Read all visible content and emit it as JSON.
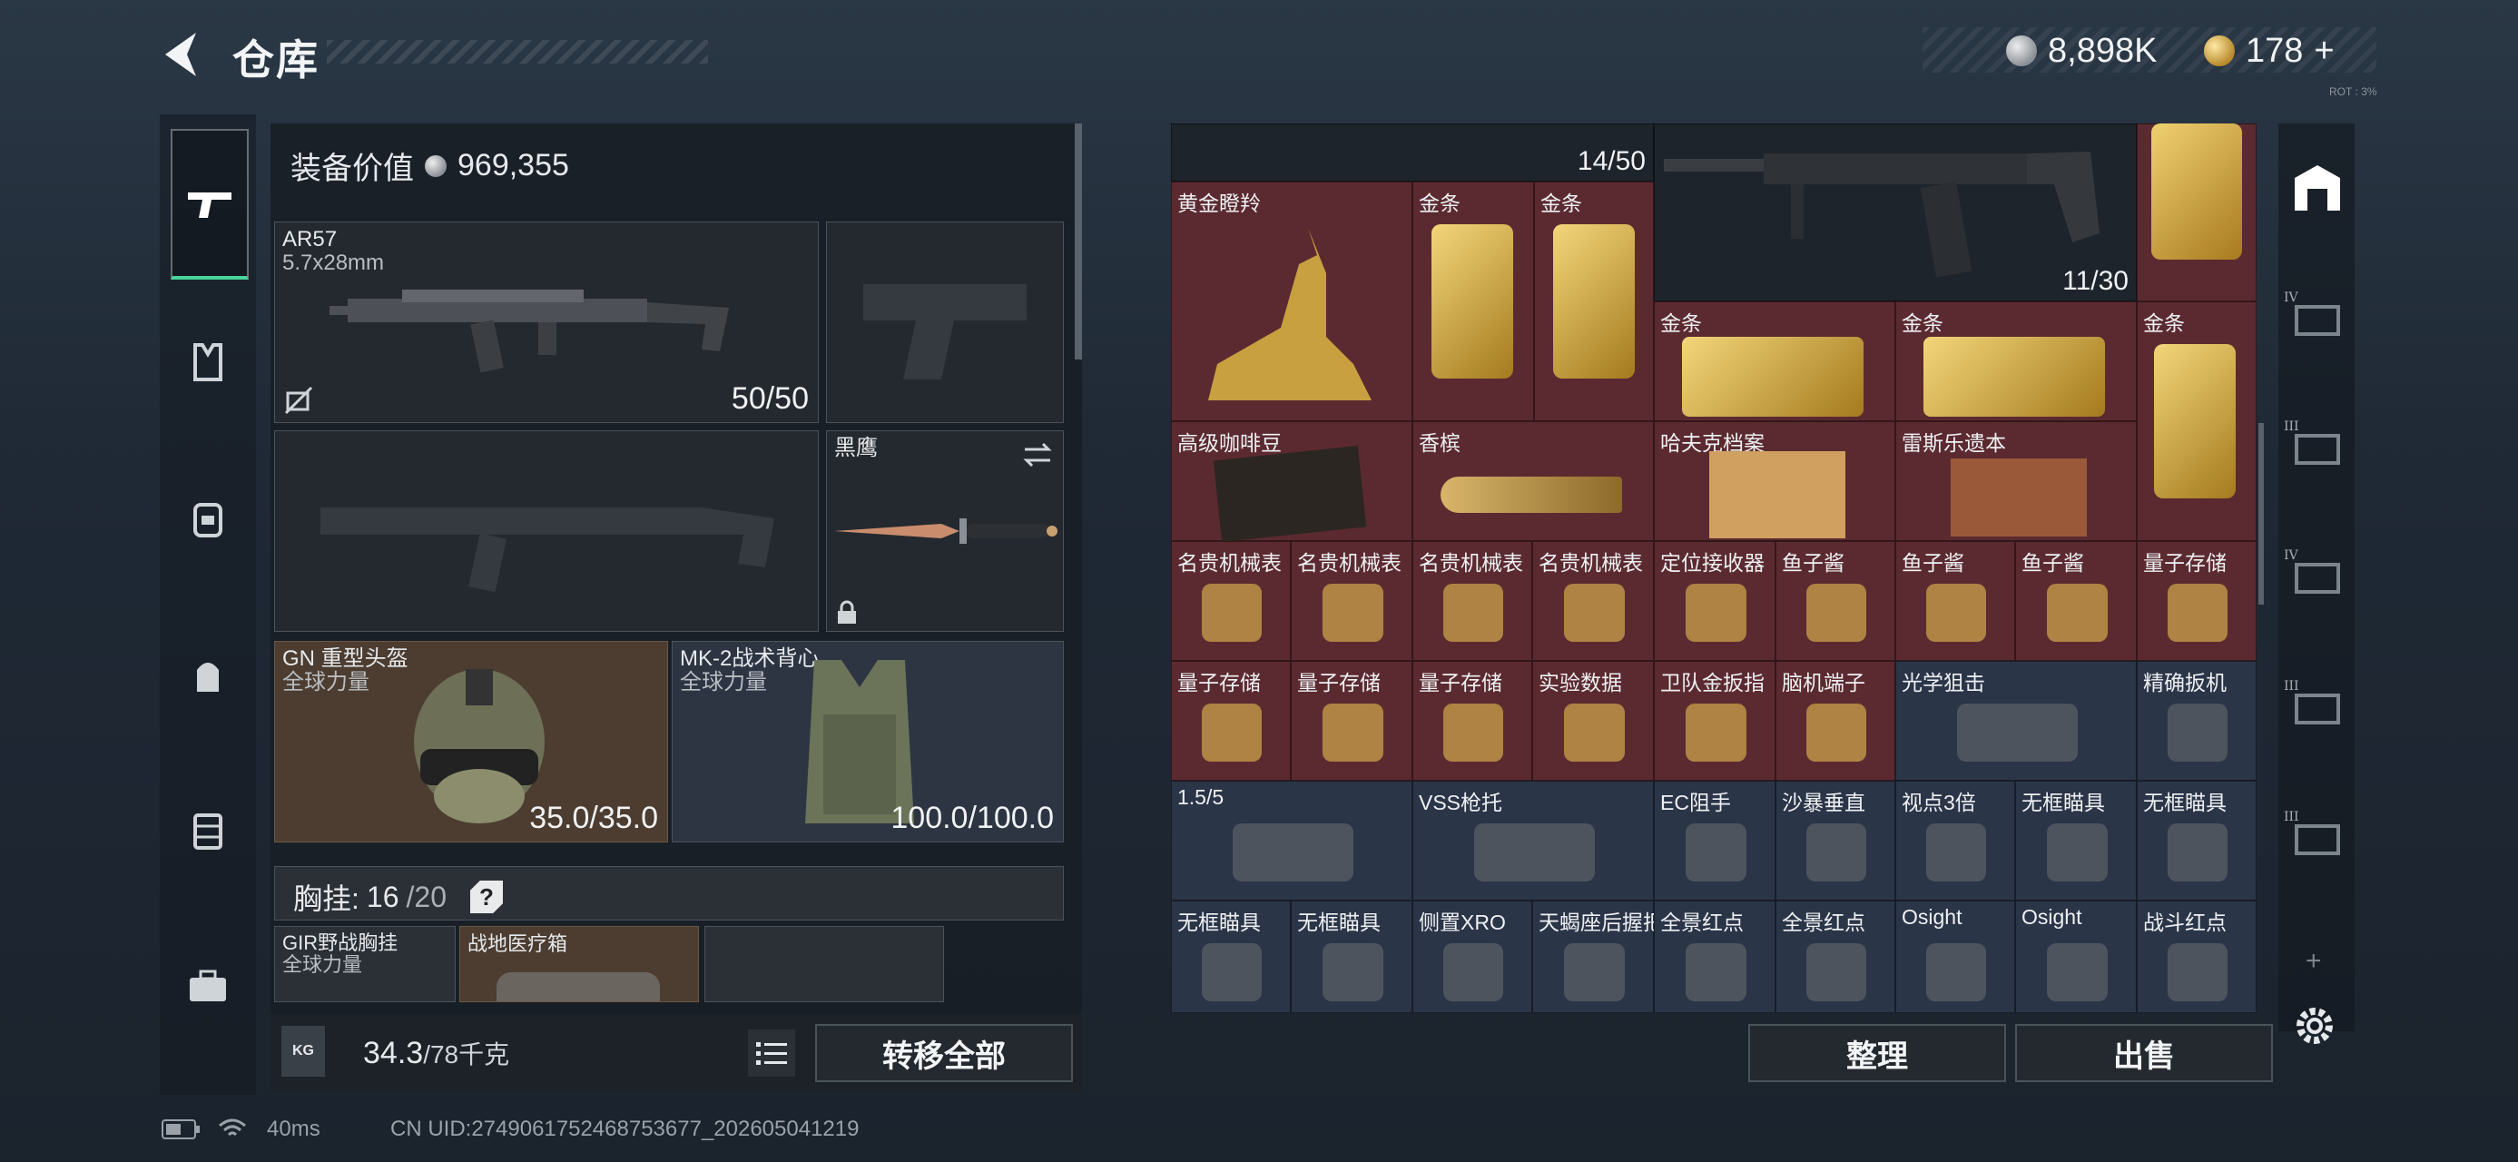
{
  "header": {
    "title": "仓库",
    "currency_silver": "8,898K",
    "currency_gold": "178",
    "currency_gold_add": "+",
    "hint_text": "ROT : 3%"
  },
  "loadout": {
    "value_label": "装备价值",
    "value": "969,355",
    "primary": {
      "name": "AR57",
      "caliber": "5.7x28mm",
      "ammo": "50/50"
    },
    "secondary_knife": {
      "name": "黑鹰"
    },
    "helmet": {
      "name": "GN 重型头盔",
      "sub": "全球力量",
      "durability": "35.0/35.0"
    },
    "vest": {
      "name": "MK-2战术背心",
      "sub": "全球力量",
      "durability": "100.0/100.0"
    },
    "rig": {
      "label": "胸挂:",
      "used": "16",
      "total": "/20",
      "help": "?"
    },
    "rig_items": [
      {
        "name": "GIR野战胸挂",
        "sub": "全球力量"
      },
      {
        "name": "战地医疗箱"
      }
    ],
    "weight": "34.3",
    "weight_max": "/78千克",
    "transfer_all": "转移全部",
    "kg_icon": "KG"
  },
  "inventory": {
    "ammo_top": "14/50",
    "rifle_ammo": "11/30",
    "items": [
      {
        "name": "黄金瞪羚"
      },
      {
        "name": "金条"
      },
      {
        "name": "金条"
      },
      {
        "name": "金条"
      },
      {
        "name": "金条"
      },
      {
        "name": "金条"
      },
      {
        "name": "高级咖啡豆"
      },
      {
        "name": "香槟"
      },
      {
        "name": "哈夫克档案"
      },
      {
        "name": "雷斯乐遗本"
      },
      {
        "name": "名贵机械表"
      },
      {
        "name": "名贵机械表"
      },
      {
        "name": "名贵机械表"
      },
      {
        "name": "名贵机械表"
      },
      {
        "name": "定位接收器"
      },
      {
        "name": "鱼子酱"
      },
      {
        "name": "鱼子酱"
      },
      {
        "name": "鱼子酱"
      },
      {
        "name": "量子存储"
      },
      {
        "name": "量子存储"
      },
      {
        "name": "量子存储"
      },
      {
        "name": "量子存储"
      },
      {
        "name": "实验数据"
      },
      {
        "name": "卫队金扳指"
      },
      {
        "name": "脑机端子"
      },
      {
        "name": "光学狙击"
      },
      {
        "name": "精确扳机"
      },
      {
        "name": "1.5/5"
      },
      {
        "name": "VSS枪托"
      },
      {
        "name": "EC阻手"
      },
      {
        "name": "沙暴垂直"
      },
      {
        "name": "视点3倍"
      },
      {
        "name": "无框瞄具"
      },
      {
        "name": "无框瞄具"
      },
      {
        "name": "无框瞄具"
      },
      {
        "name": "无框瞄具"
      },
      {
        "name": "侧置XRO"
      },
      {
        "name": "天蝎座后握把"
      },
      {
        "name": "全景红点"
      },
      {
        "name": "全景红点"
      },
      {
        "name": "Osight"
      },
      {
        "name": "Osight"
      },
      {
        "name": "战斗红点"
      }
    ],
    "organize": "整理",
    "sell": "出售"
  },
  "right_sidebar": {
    "tiers": [
      "IV",
      "III",
      "IV",
      "III",
      "III"
    ],
    "add": "+"
  },
  "status": {
    "ping": "40ms",
    "uid": "CN UID:2749061752468753677_202605041219"
  },
  "colors": {
    "accent": "#48d49a",
    "red_cell": "#5b2a30",
    "blue_cell": "#2b3548"
  }
}
